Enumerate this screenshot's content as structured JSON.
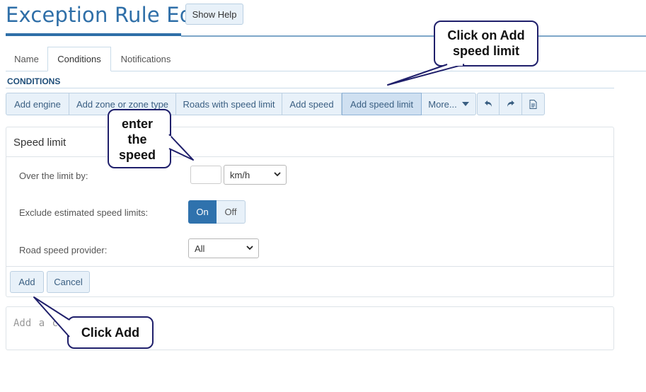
{
  "header": {
    "title": "Exception Rule Edit",
    "help_label": "Show Help"
  },
  "tabs": [
    {
      "label": "Name"
    },
    {
      "label": "Conditions"
    },
    {
      "label": "Notifications"
    }
  ],
  "active_tab": "Conditions",
  "section": {
    "label": "CONDITIONS"
  },
  "toolbar": {
    "add_engine": "Add engine",
    "add_zone": "Add zone or zone type",
    "roads_speed_limit": "Roads with speed limit",
    "add_speed": "Add speed",
    "add_speed_limit": "Add speed limit",
    "more": "More...",
    "undo_icon": "undo-icon",
    "redo_icon": "redo-icon",
    "document_icon": "document-icon"
  },
  "panel": {
    "title": "Speed limit",
    "over_limit_label": "Over the limit by:",
    "over_limit_value": "",
    "unit_selected": "km/h",
    "exclude_label": "Exclude estimated speed limits:",
    "toggle_on": "On",
    "toggle_off": "Off",
    "toggle_state": "On",
    "provider_label": "Road speed provider:",
    "provider_selected": "All",
    "add_button": "Add",
    "cancel_button": "Cancel"
  },
  "comment": {
    "placeholder": "Add a co"
  },
  "callouts": {
    "add_speed_limit_line1": "Click on Add",
    "add_speed_limit_line2": "speed limit",
    "enter_speed_line1": "enter",
    "enter_speed_line2": "the",
    "enter_speed_line3": "speed",
    "click_add": "Click Add"
  },
  "colors": {
    "accent": "#2f6fa8",
    "button_bg": "#e8f1f9",
    "toggle_on": "#2f72ad",
    "callout_border": "#1f1f6b"
  }
}
